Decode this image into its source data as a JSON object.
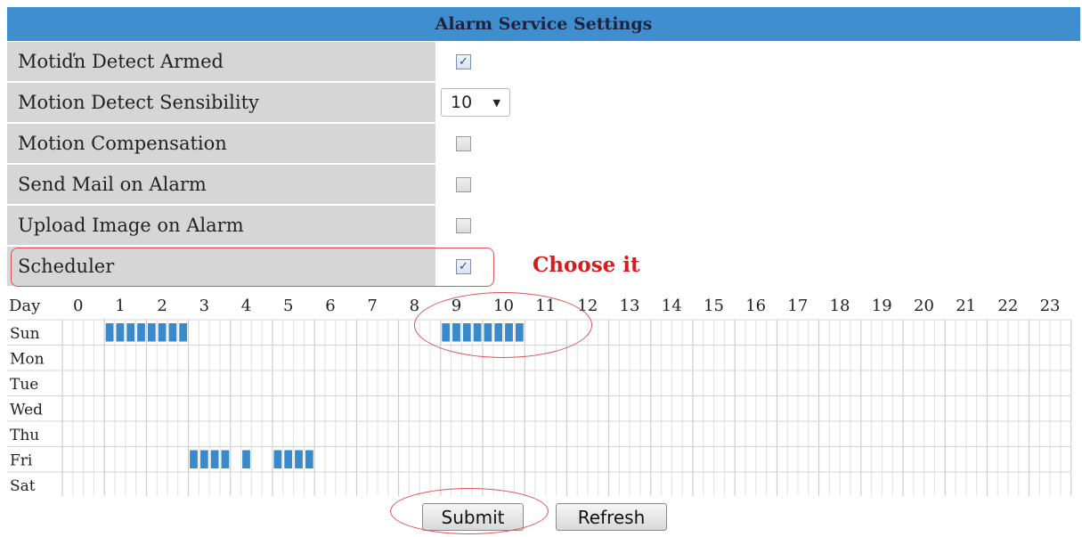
{
  "title": "Alarm Service Settings",
  "settings": [
    {
      "label": "Motiďn Detect Armed",
      "type": "checkbox",
      "checked": true
    },
    {
      "label": "Motion Detect Sensibility",
      "type": "select",
      "value": "10"
    },
    {
      "label": "Motion Compensation",
      "type": "checkbox",
      "checked": false
    },
    {
      "label": "Send Mail on Alarm",
      "type": "checkbox",
      "checked": false
    },
    {
      "label": "Upload Image on Alarm",
      "type": "checkbox",
      "checked": false
    },
    {
      "label": "Scheduler",
      "type": "checkbox",
      "checked": true
    }
  ],
  "annotation": "Choose it",
  "schedule": {
    "header_label": "Day",
    "hours": [
      "0",
      "1",
      "2",
      "3",
      "4",
      "5",
      "6",
      "7",
      "8",
      "9",
      "10",
      "11",
      "12",
      "13",
      "14",
      "15",
      "16",
      "17",
      "18",
      "19",
      "20",
      "21",
      "22",
      "23"
    ],
    "days": [
      "Sun",
      "Mon",
      "Tue",
      "Wed",
      "Thu",
      "Fri",
      "Sat"
    ],
    "slots_per_hour": 4,
    "selected": {
      "Sun": [
        [
          1,
          3
        ],
        [
          9,
          11
        ]
      ],
      "Mon": [],
      "Tue": [],
      "Wed": [],
      "Thu": [],
      "Fri": [
        [
          3,
          4
        ],
        [
          4.25,
          4.5
        ],
        [
          5,
          6
        ]
      ],
      "Sat": []
    }
  },
  "buttons": {
    "submit": "Submit",
    "refresh": "Refresh"
  },
  "colors": {
    "header_bg": "#3f8fd0",
    "selected_slot": "#3a8acb",
    "annotation": "#d81c1c"
  }
}
